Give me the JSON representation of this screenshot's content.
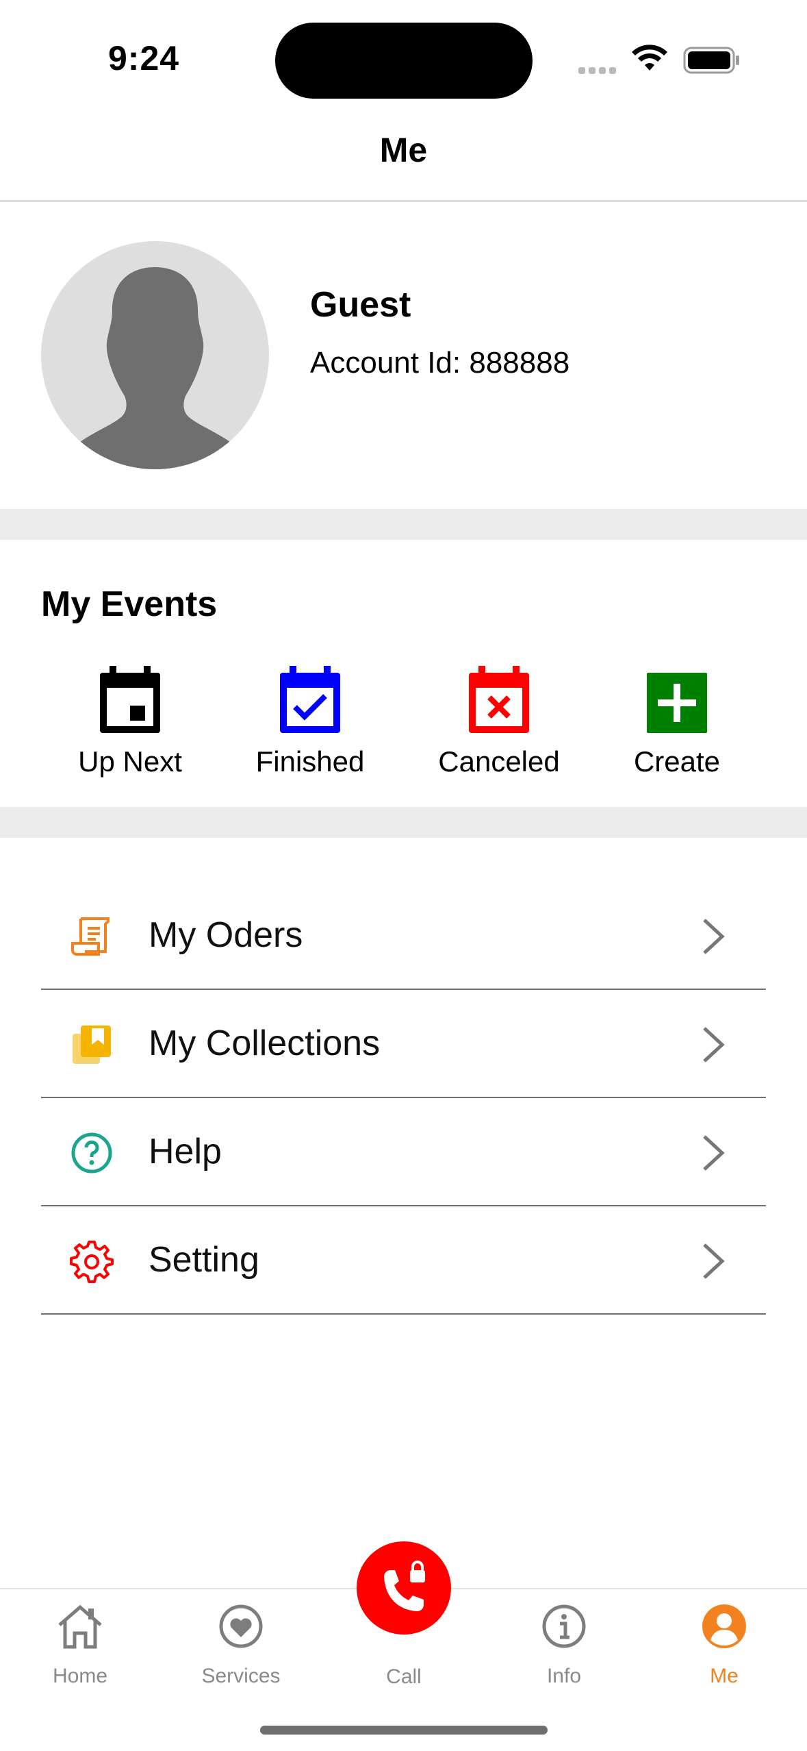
{
  "status_bar": {
    "time": "9:24"
  },
  "nav": {
    "title": "Me"
  },
  "profile": {
    "name": "Guest",
    "account_id": "Account Id: 888888"
  },
  "events": {
    "title": "My Events",
    "items": [
      {
        "label": "Up Next",
        "icon": "calendar-icon",
        "color": "#000000"
      },
      {
        "label": "Finished",
        "icon": "calendar-check-icon",
        "color": "#0000ff"
      },
      {
        "label": "Canceled",
        "icon": "calendar-x-icon",
        "color": "#ff0000"
      },
      {
        "label": "Create",
        "icon": "plus-box-icon",
        "color": "#008000"
      }
    ]
  },
  "menu": [
    {
      "label": "My Oders",
      "icon": "receipt-icon",
      "color": "#f2821f"
    },
    {
      "label": "My Collections",
      "icon": "bookmark-icon",
      "color": "#f5b400"
    },
    {
      "label": "Help",
      "icon": "help-icon",
      "color": "#1aa58f"
    },
    {
      "label": "Setting",
      "icon": "gear-icon",
      "color": "#ff0000"
    }
  ],
  "tabbar": {
    "items": [
      {
        "label": "Home",
        "icon": "home-icon"
      },
      {
        "label": "Services",
        "icon": "heart-icon"
      },
      {
        "label": "Call",
        "icon": "phone-icon"
      },
      {
        "label": "Info",
        "icon": "info-icon"
      },
      {
        "label": "Me",
        "icon": "user-icon"
      }
    ],
    "active": "Me",
    "active_color": "#f2821f",
    "call_color": "#ff0000"
  }
}
